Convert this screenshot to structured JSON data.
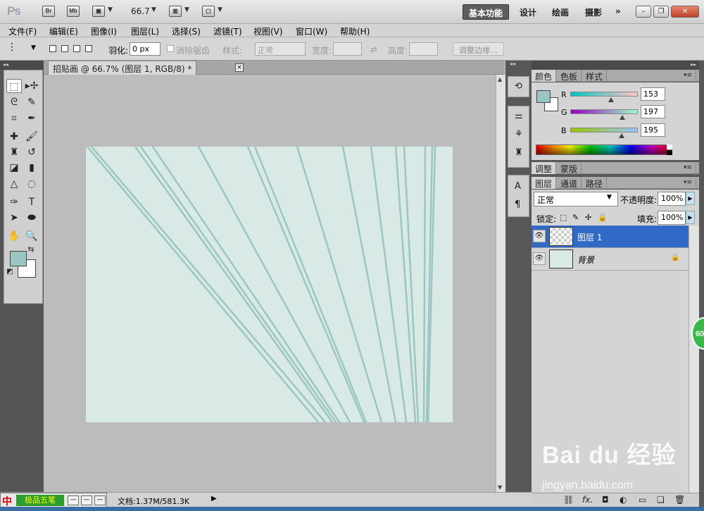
{
  "app": {
    "logo": "Ps",
    "bridge_btn": "Br",
    "minibridge_btn": "Mb",
    "zoom": "66.7",
    "workspaces": [
      "基本功能",
      "设计",
      "绘画",
      "摄影"
    ],
    "more": "»"
  },
  "menu": [
    "文件(F)",
    "编辑(E)",
    "图像(I)",
    "图层(L)",
    "选择(S)",
    "滤镜(T)",
    "视图(V)",
    "窗口(W)",
    "帮助(H)"
  ],
  "options": {
    "feather_label": "羽化:",
    "feather_value": "0 px",
    "antialias_label": "消除锯齿",
    "style_label": "样式:",
    "style_value": "正常",
    "width_label": "宽度:",
    "height_label": "高度:",
    "refine_edge": "调整边缘..."
  },
  "document": {
    "tab_title": "招贴画 @ 66.7% (图层 1, RGB/8) *",
    "close": "×",
    "canvas_color": "#d9e9e5",
    "line_color": "#9cc6c2"
  },
  "status": {
    "doc_info": "文档:1.37M/581.3K",
    "ime_icon": "中",
    "ime_label": "极品五笔"
  },
  "color_panel": {
    "tabs": [
      "颜色",
      "色板",
      "样式"
    ],
    "r_label": "R",
    "g_label": "G",
    "b_label": "B",
    "r": 153,
    "g": 197,
    "b": 195,
    "foreground": "#99c5c3"
  },
  "adjust_panel": {
    "tabs": [
      "调整",
      "蒙版"
    ]
  },
  "layers_panel": {
    "tabs": [
      "图层",
      "通道",
      "路径"
    ],
    "blend_mode": "正常",
    "opacity_label": "不透明度:",
    "opacity": "100%",
    "lock_label": "锁定:",
    "fill_label": "填充:",
    "fill": "100%",
    "layers": [
      {
        "name": "图层 1",
        "active": true
      },
      {
        "name": "背景",
        "active": false
      }
    ],
    "footer_icons": [
      "link-icon",
      "fx-icon",
      "mask-icon",
      "adjustment-icon",
      "group-icon",
      "new-layer-icon",
      "trash-icon"
    ],
    "fx": "fx."
  },
  "overlay": {
    "badge": "60",
    "watermark": "Bai du 经验",
    "watermark_url": "jingyan.baidu.com"
  }
}
